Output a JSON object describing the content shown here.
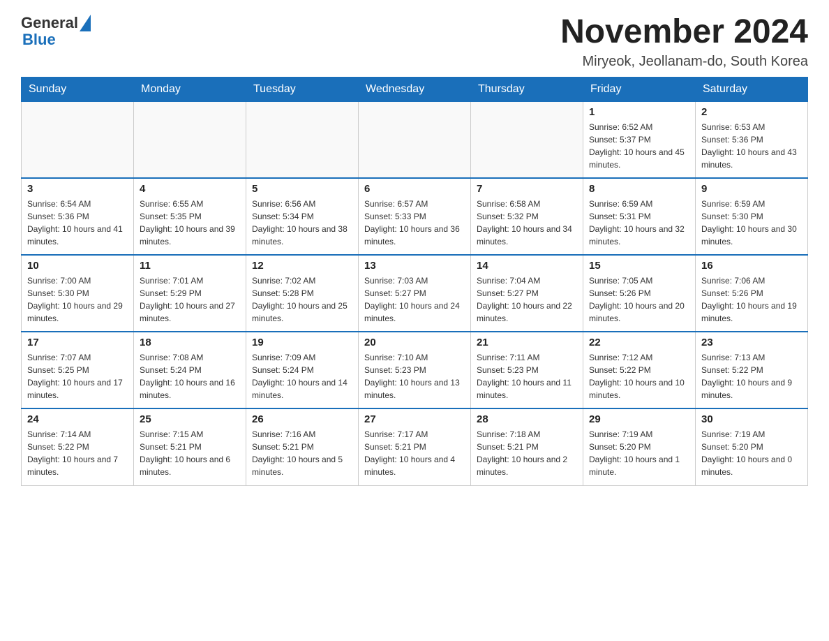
{
  "header": {
    "logo_general": "General",
    "logo_blue": "Blue",
    "month_title": "November 2024",
    "location": "Miryeok, Jeollanam-do, South Korea"
  },
  "days_of_week": [
    "Sunday",
    "Monday",
    "Tuesday",
    "Wednesday",
    "Thursday",
    "Friday",
    "Saturday"
  ],
  "weeks": [
    [
      {
        "day": "",
        "info": ""
      },
      {
        "day": "",
        "info": ""
      },
      {
        "day": "",
        "info": ""
      },
      {
        "day": "",
        "info": ""
      },
      {
        "day": "",
        "info": ""
      },
      {
        "day": "1",
        "info": "Sunrise: 6:52 AM\nSunset: 5:37 PM\nDaylight: 10 hours and 45 minutes."
      },
      {
        "day": "2",
        "info": "Sunrise: 6:53 AM\nSunset: 5:36 PM\nDaylight: 10 hours and 43 minutes."
      }
    ],
    [
      {
        "day": "3",
        "info": "Sunrise: 6:54 AM\nSunset: 5:36 PM\nDaylight: 10 hours and 41 minutes."
      },
      {
        "day": "4",
        "info": "Sunrise: 6:55 AM\nSunset: 5:35 PM\nDaylight: 10 hours and 39 minutes."
      },
      {
        "day": "5",
        "info": "Sunrise: 6:56 AM\nSunset: 5:34 PM\nDaylight: 10 hours and 38 minutes."
      },
      {
        "day": "6",
        "info": "Sunrise: 6:57 AM\nSunset: 5:33 PM\nDaylight: 10 hours and 36 minutes."
      },
      {
        "day": "7",
        "info": "Sunrise: 6:58 AM\nSunset: 5:32 PM\nDaylight: 10 hours and 34 minutes."
      },
      {
        "day": "8",
        "info": "Sunrise: 6:59 AM\nSunset: 5:31 PM\nDaylight: 10 hours and 32 minutes."
      },
      {
        "day": "9",
        "info": "Sunrise: 6:59 AM\nSunset: 5:30 PM\nDaylight: 10 hours and 30 minutes."
      }
    ],
    [
      {
        "day": "10",
        "info": "Sunrise: 7:00 AM\nSunset: 5:30 PM\nDaylight: 10 hours and 29 minutes."
      },
      {
        "day": "11",
        "info": "Sunrise: 7:01 AM\nSunset: 5:29 PM\nDaylight: 10 hours and 27 minutes."
      },
      {
        "day": "12",
        "info": "Sunrise: 7:02 AM\nSunset: 5:28 PM\nDaylight: 10 hours and 25 minutes."
      },
      {
        "day": "13",
        "info": "Sunrise: 7:03 AM\nSunset: 5:27 PM\nDaylight: 10 hours and 24 minutes."
      },
      {
        "day": "14",
        "info": "Sunrise: 7:04 AM\nSunset: 5:27 PM\nDaylight: 10 hours and 22 minutes."
      },
      {
        "day": "15",
        "info": "Sunrise: 7:05 AM\nSunset: 5:26 PM\nDaylight: 10 hours and 20 minutes."
      },
      {
        "day": "16",
        "info": "Sunrise: 7:06 AM\nSunset: 5:26 PM\nDaylight: 10 hours and 19 minutes."
      }
    ],
    [
      {
        "day": "17",
        "info": "Sunrise: 7:07 AM\nSunset: 5:25 PM\nDaylight: 10 hours and 17 minutes."
      },
      {
        "day": "18",
        "info": "Sunrise: 7:08 AM\nSunset: 5:24 PM\nDaylight: 10 hours and 16 minutes."
      },
      {
        "day": "19",
        "info": "Sunrise: 7:09 AM\nSunset: 5:24 PM\nDaylight: 10 hours and 14 minutes."
      },
      {
        "day": "20",
        "info": "Sunrise: 7:10 AM\nSunset: 5:23 PM\nDaylight: 10 hours and 13 minutes."
      },
      {
        "day": "21",
        "info": "Sunrise: 7:11 AM\nSunset: 5:23 PM\nDaylight: 10 hours and 11 minutes."
      },
      {
        "day": "22",
        "info": "Sunrise: 7:12 AM\nSunset: 5:22 PM\nDaylight: 10 hours and 10 minutes."
      },
      {
        "day": "23",
        "info": "Sunrise: 7:13 AM\nSunset: 5:22 PM\nDaylight: 10 hours and 9 minutes."
      }
    ],
    [
      {
        "day": "24",
        "info": "Sunrise: 7:14 AM\nSunset: 5:22 PM\nDaylight: 10 hours and 7 minutes."
      },
      {
        "day": "25",
        "info": "Sunrise: 7:15 AM\nSunset: 5:21 PM\nDaylight: 10 hours and 6 minutes."
      },
      {
        "day": "26",
        "info": "Sunrise: 7:16 AM\nSunset: 5:21 PM\nDaylight: 10 hours and 5 minutes."
      },
      {
        "day": "27",
        "info": "Sunrise: 7:17 AM\nSunset: 5:21 PM\nDaylight: 10 hours and 4 minutes."
      },
      {
        "day": "28",
        "info": "Sunrise: 7:18 AM\nSunset: 5:21 PM\nDaylight: 10 hours and 2 minutes."
      },
      {
        "day": "29",
        "info": "Sunrise: 7:19 AM\nSunset: 5:20 PM\nDaylight: 10 hours and 1 minute."
      },
      {
        "day": "30",
        "info": "Sunrise: 7:19 AM\nSunset: 5:20 PM\nDaylight: 10 hours and 0 minutes."
      }
    ]
  ]
}
